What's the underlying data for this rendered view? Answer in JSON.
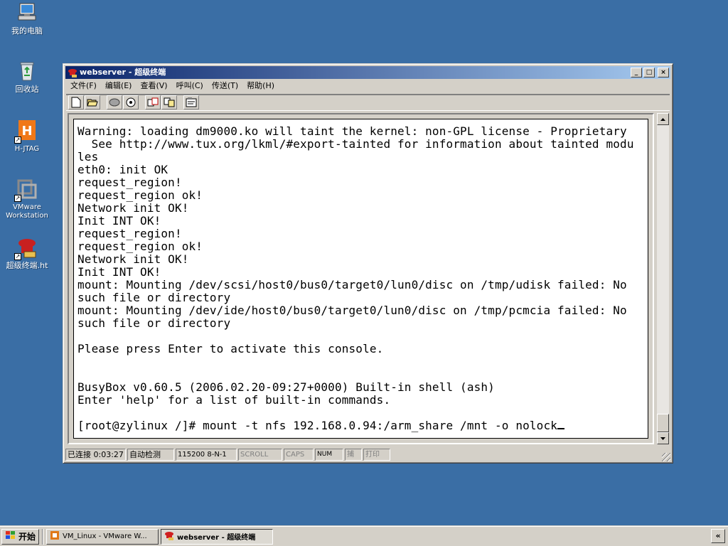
{
  "desktop": {
    "icons": [
      {
        "label": "我的电脑"
      },
      {
        "label": "回收站"
      },
      {
        "label": "H-JTAG"
      },
      {
        "label": "VMware Workstation"
      },
      {
        "label": "超级终端.ht"
      }
    ]
  },
  "window": {
    "title": "webserver - 超级终端",
    "menu": [
      "文件(F)",
      "编辑(E)",
      "查看(V)",
      "呼叫(C)",
      "传送(T)",
      "帮助(H)"
    ],
    "toolbar_icons": [
      "new-icon",
      "open-icon",
      "disconnect-icon",
      "dial-icon",
      "send-icon",
      "receive-icon",
      "properties-icon"
    ],
    "terminal_lines": [
      "Warning: loading dm9000.ko will taint the kernel: non-GPL license - Proprietary",
      "  See http://www.tux.org/lkml/#export-tainted for information about tainted modu",
      "les",
      "eth0: init OK",
      "request_region!",
      "request_region ok!",
      "Network init OK!",
      "Init INT OK!",
      "request_region!",
      "request_region ok!",
      "Network init OK!",
      "Init INT OK!",
      "mount: Mounting /dev/scsi/host0/bus0/target0/lun0/disc on /tmp/udisk failed: No",
      "such file or directory",
      "mount: Mounting /dev/ide/host0/bus0/target0/lun0/disc on /tmp/pcmcia failed: No",
      "such file or directory",
      "",
      "Please press Enter to activate this console.",
      "",
      "",
      "BusyBox v0.60.5 (2006.02.20-09:27+0000) Built-in shell (ash)",
      "Enter 'help' for a list of built-in commands.",
      "",
      "[root@zylinux /]# mount -t nfs 192.168.0.94:/arm_share /mnt -o nolock"
    ],
    "status": {
      "connected": "已连接 0:03:27",
      "detect": "自动检测",
      "port": "115200 8-N-1",
      "scroll": "SCROLL",
      "caps": "CAPS",
      "num": "NUM",
      "capture": "捕",
      "print": "打印"
    }
  },
  "taskbar": {
    "start": "开始",
    "tasks": [
      {
        "label": "VM_Linux - VMware W..."
      },
      {
        "label": "webserver - 超级终端"
      }
    ],
    "tray_chevron": "«"
  }
}
